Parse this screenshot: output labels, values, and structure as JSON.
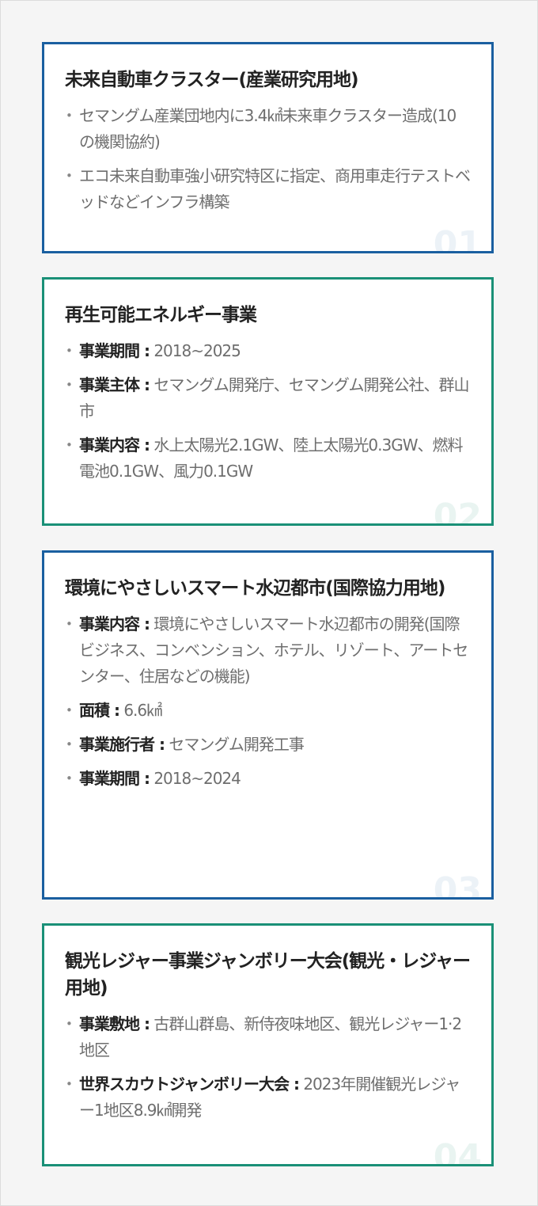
{
  "cards": [
    {
      "title": "未来自動車クラスター(産業研究用地)",
      "items": [
        {
          "text": "セマングム産業団地内に3.4㎢未来車クラスター造成(10の機関協約)"
        },
        {
          "text": "エコ未来自動車強小研究特区に指定、商用車走行テストベッドなどインフラ構築"
        }
      ],
      "number": "01"
    },
    {
      "title": "再生可能エネルギー事業",
      "items": [
        {
          "label": "事業期間 :",
          "text": " 2018~2025"
        },
        {
          "label": "事業主体 :",
          "text": " セマングム開発庁、セマングム開発公社、群山市"
        },
        {
          "label": "事業内容 :",
          "text": " 水上太陽光2.1GW、陸上太陽光0.3GW、燃料電池0.1GW、風力0.1GW"
        }
      ],
      "number": "02"
    },
    {
      "title": "環境にやさしいスマート水辺都市(国際協力用地)",
      "items": [
        {
          "label": "事業内容 :",
          "text": " 環境にやさしいスマート水辺都市の開発(国際ビジネス、コンベンション、ホテル、リゾート、アートセンター、住居などの機能)"
        },
        {
          "label": "面積 :",
          "text": " 6.6㎢"
        },
        {
          "label": "事業施行者 :",
          "text": " セマングム開発工事"
        },
        {
          "label": "事業期間 :",
          "text": " 2018~2024"
        }
      ],
      "number": "03"
    },
    {
      "title": "観光レジャー事業ジャンボリー大会(観光・レジャー用地)",
      "items": [
        {
          "label": "事業敷地 :",
          "text": " 古群山群島、新侍夜味地区、観光レジャー1·2地区"
        },
        {
          "label": "世界スカウトジャンボリー大会 :",
          "text": " 2023年開催観光レジャー1地区8.9㎢開発"
        }
      ],
      "number": "04"
    }
  ]
}
